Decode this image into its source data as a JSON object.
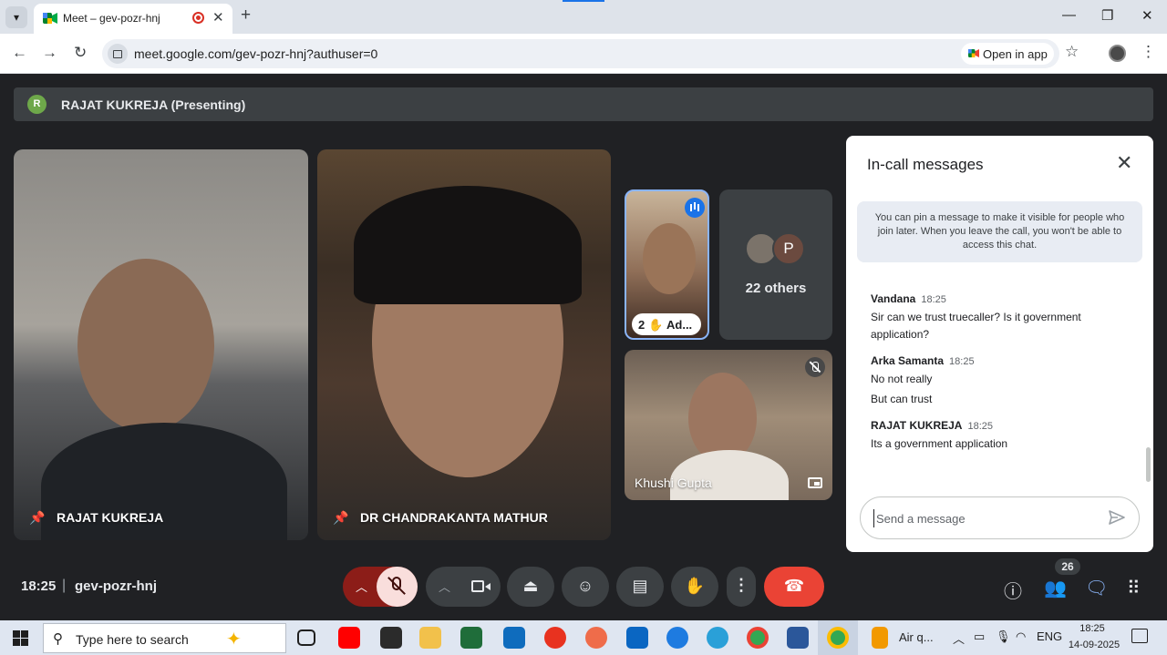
{
  "browser": {
    "tab_title": "Meet – gev-pozr-hnj",
    "url": "meet.google.com/gev-pozr-hnj?authuser=0",
    "open_in_app": "Open in app"
  },
  "meet": {
    "presenting_initial": "R",
    "presenting_text": "RAJAT KUKREJA (Presenting)",
    "tiles": {
      "t1_name": "RAJAT KUKREJA",
      "t2_name": "DR CHANDRAKANTA MATHUR",
      "t3_hand_count": "2",
      "t3_name": "Ad...",
      "others_initial": "P",
      "others_label": "22 others",
      "t5_name": "Khushi Gupta"
    },
    "chat": {
      "title": "In-call messages",
      "info": "You can pin a message to make it visible for people who join later. When you leave the call, you won't be able to access this chat.",
      "messages": [
        {
          "sender": "Vandana",
          "time": "18:25",
          "lines": [
            "Sir can we trust truecaller? Is it government application?"
          ]
        },
        {
          "sender": "Arka Samanta",
          "time": "18:25",
          "lines": [
            "No not really",
            "But can trust"
          ]
        },
        {
          "sender": "RAJAT KUKREJA",
          "time": "18:25",
          "lines": [
            "Its a government application"
          ]
        }
      ],
      "placeholder": "Send a message"
    },
    "bottom": {
      "time": "18:25",
      "separator": "|",
      "code": "gev-pozr-hnj",
      "people_count": "26"
    }
  },
  "taskbar": {
    "search_placeholder": "Type here to search",
    "airq_label": "Air q...",
    "lang": "ENG",
    "time": "18:25",
    "date": "14-09-2025"
  },
  "colors": {
    "meet_bg": "#202124",
    "control_bg": "#3c4043",
    "hangup": "#ea4335",
    "mic_off": "#f9dedc",
    "accent": "#8ab4f8"
  }
}
